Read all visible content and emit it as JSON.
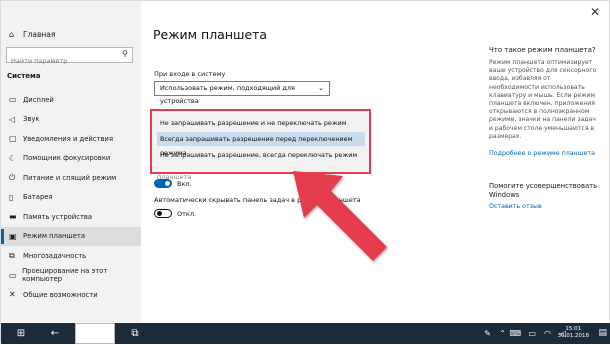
{
  "sidebar": {
    "home_label": "Главная",
    "search_placeholder": "Найти параметр",
    "section_title": "Система",
    "items": [
      {
        "label": "Дисплей",
        "icon": "display-icon"
      },
      {
        "label": "Звук",
        "icon": "speaker-icon"
      },
      {
        "label": "Уведомления и действия",
        "icon": "notifications-icon"
      },
      {
        "label": "Помощник фокусировки",
        "icon": "moon-icon"
      },
      {
        "label": "Питание и спящий режим",
        "icon": "power-icon"
      },
      {
        "label": "Батарея",
        "icon": "battery-icon"
      },
      {
        "label": "Память устройства",
        "icon": "storage-icon"
      },
      {
        "label": "Режим планшета",
        "icon": "tablet-icon",
        "active": true
      },
      {
        "label": "Многозадачность",
        "icon": "multitasking-icon"
      },
      {
        "label": "Проецирование на этот компьютер",
        "icon": "projecting-icon"
      },
      {
        "label": "Общие возможности",
        "icon": "shared-experiences-icon"
      }
    ]
  },
  "main": {
    "title": "Режим планшета",
    "login_label": "При входе в систему",
    "login_value": "Использовать режим, подходящий для устройства",
    "dropdown_options": [
      "Не запрашивать разрешение и не переключать режим",
      "Всегда запрашивать разрешение перед переключением режима",
      "Не запрашивать разрешение, всегда переключать режим"
    ],
    "partial_text": "планшета",
    "toggle1_label": "Вкл.",
    "taskbar_label": "Автоматически скрывать панель задач в режиме планшета",
    "toggle2_label": "Откл."
  },
  "right_panel": {
    "title": "Что такое режим планшета?",
    "text": "Режим планшета оптимизирует ваше устройство для сенсорного ввода, избавляя от необходимости использовать клавиатуру и мышь. Если режим планшета включен, приложения открываются в полноэкранном режиме, значки на панели задач и рабочем столе уменьшаются в размерах.",
    "link": "Подробнее о режиме планшета",
    "feedback_title": "Помогите усовершенствовать Windows",
    "feedback_link": "Оставить отзыв"
  },
  "taskbar": {
    "time": "15:01",
    "date": "30.01.2018"
  },
  "colors": {
    "accent": "#0063b1",
    "highlight_border": "#e53d4b",
    "arrow": "#e53d4b"
  }
}
